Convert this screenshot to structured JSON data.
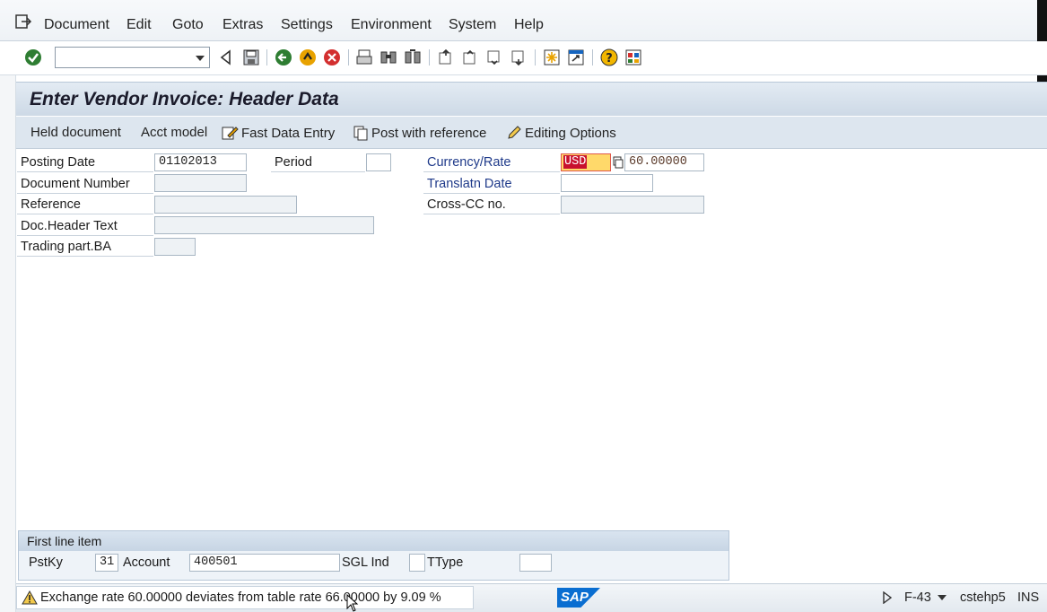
{
  "menu": {
    "items": [
      "Document",
      "Edit",
      "Goto",
      "Extras",
      "Settings",
      "Environment",
      "System",
      "Help"
    ]
  },
  "toolbar": {
    "command_field_value": ""
  },
  "title": "Enter Vendor Invoice: Header Data",
  "app_toolbar": {
    "held_document": "Held document",
    "acct_model": "Acct model",
    "fast_data_entry": "Fast Data Entry",
    "post_with_reference": "Post with reference",
    "editing_options": "Editing Options"
  },
  "form": {
    "posting_date_label": "Posting Date",
    "posting_date_value": "01102013",
    "period_label": "Period",
    "period_value": "",
    "document_number_label": "Document Number",
    "document_number_value": "",
    "reference_label": "Reference",
    "reference_value": "",
    "doc_header_text_label": "Doc.Header Text",
    "doc_header_text_value": "",
    "trading_part_label": "Trading part.BA",
    "trading_part_value": "",
    "currency_rate_label": "Currency/Rate",
    "currency_value": "USD",
    "rate_value": "60.00000",
    "translatn_date_label": "Translatn Date",
    "translatn_date_value": "",
    "cross_cc_label": "Cross-CC no.",
    "cross_cc_value": ""
  },
  "first_line_item": {
    "heading": "First line item",
    "pstky_label": "PstKy",
    "pstky_value": "31",
    "account_label": "Account",
    "account_value": "400501",
    "sgl_ind_label": "SGL Ind",
    "sgl_ind_value": "",
    "ttype_label": "TType",
    "ttype_value": ""
  },
  "status": {
    "message": "Exchange rate  60.00000 deviates from table rate  66.00000 by 9.09 %",
    "logo": "SAP",
    "transaction": "F-43",
    "server": "cstehp5",
    "mode": "INS"
  },
  "colors": {
    "currency_field_bg": "#c8102e",
    "currency_highlight": "#ffd96a",
    "sap_logo": "#0a6ed1"
  }
}
